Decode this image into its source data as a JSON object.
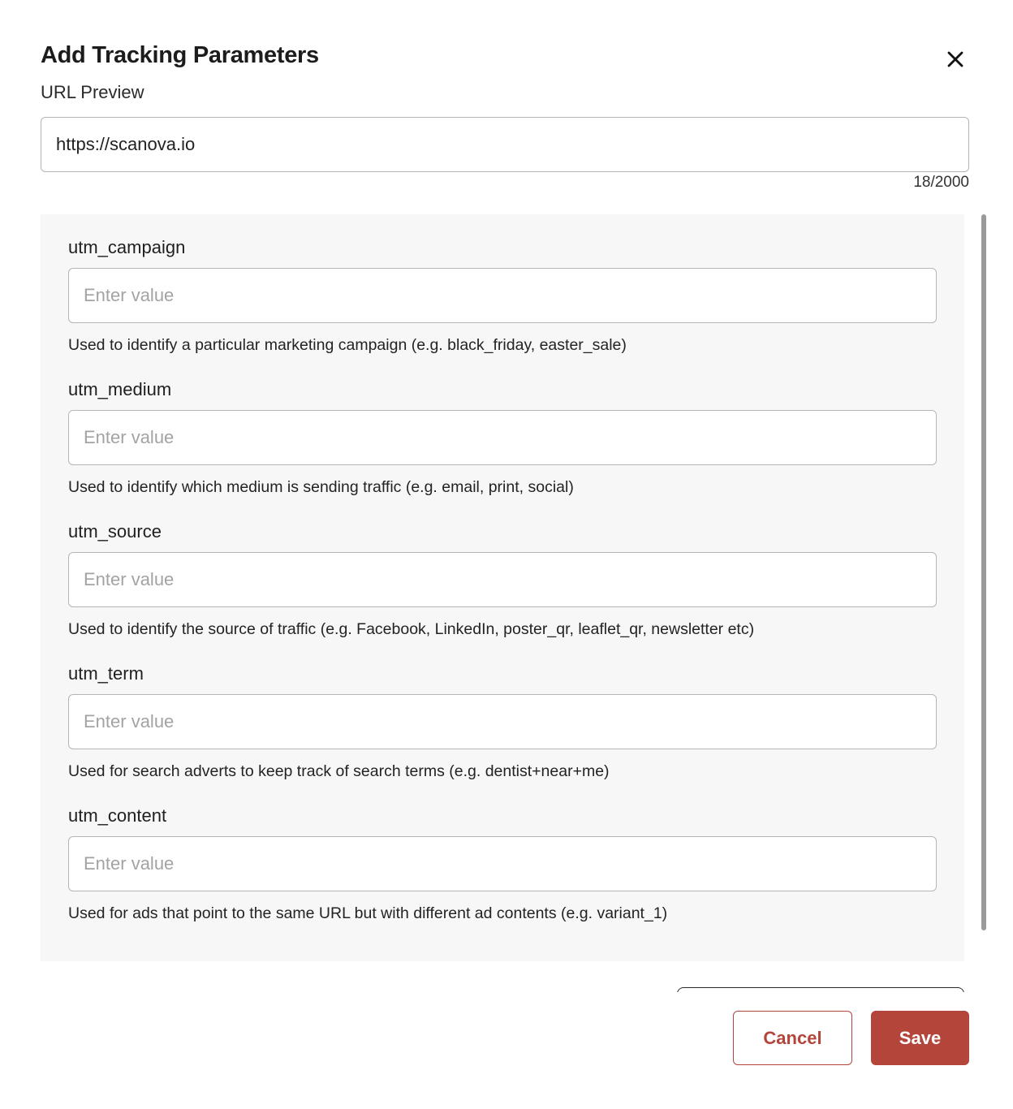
{
  "dialog": {
    "title": "Add Tracking Parameters",
    "close_icon": "close-icon"
  },
  "url_preview": {
    "label": "URL Preview",
    "value": "https://scanova.io",
    "char_count": "18/2000"
  },
  "params": [
    {
      "label": "utm_campaign",
      "placeholder": "Enter value",
      "help": "Used to identify a particular marketing campaign (e.g. black_friday, easter_sale)"
    },
    {
      "label": "utm_medium",
      "placeholder": "Enter value",
      "help": "Used to identify which medium is sending traffic (e.g. email, print, social)"
    },
    {
      "label": "utm_source",
      "placeholder": "Enter value",
      "help": "Used to identify the source of traffic (e.g. Facebook, LinkedIn, poster_qr, leaflet_qr, newsletter etc)"
    },
    {
      "label": "utm_term",
      "placeholder": "Enter value",
      "help": "Used for search adverts to keep track of search terms (e.g. dentist+near+me)"
    },
    {
      "label": "utm_content",
      "placeholder": "Enter value",
      "help": "Used for ads that point to the same URL but with different ad contents (e.g. variant_1)"
    }
  ],
  "footer": {
    "cancel_label": "Cancel",
    "save_label": "Save"
  },
  "colors": {
    "accent": "#b4453a",
    "panel_bg": "#f7f7f7",
    "border": "#b5b5b5"
  }
}
